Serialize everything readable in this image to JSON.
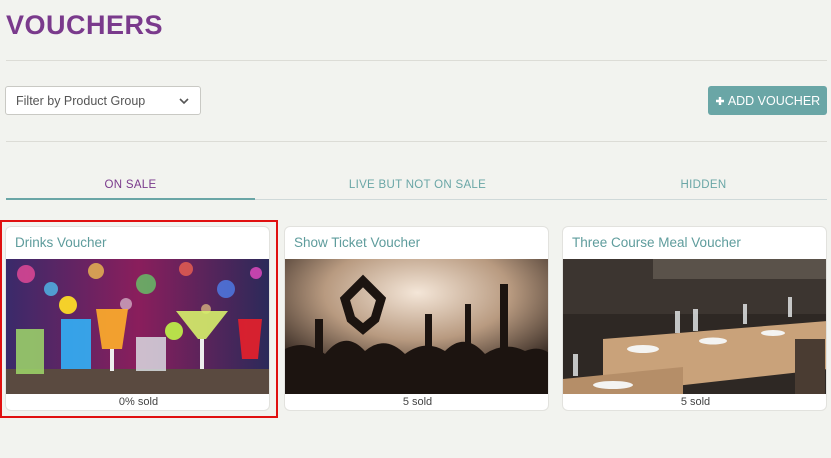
{
  "header": {
    "title": "VOUCHERS"
  },
  "filter": {
    "placeholder": "Filter by Product Group",
    "icon": "chevron-down-icon"
  },
  "actions": {
    "add_label": "ADD VOUCHER",
    "add_icon": "plus-icon"
  },
  "tabs": [
    {
      "label": "ON SALE",
      "active": true
    },
    {
      "label": "LIVE BUT NOT ON SALE",
      "active": false
    },
    {
      "label": "HIDDEN",
      "active": false
    }
  ],
  "vouchers": [
    {
      "name": "Drinks Voucher",
      "sold": "0% sold",
      "selected": true
    },
    {
      "name": "Show Ticket Voucher",
      "sold": "5 sold",
      "selected": false
    },
    {
      "name": "Three Course Meal Voucher",
      "sold": "5 sold",
      "selected": false
    }
  ],
  "colors": {
    "brand_purple": "#7a3a8c",
    "accent_teal": "#6aa6a6",
    "background": "#f2f3ef",
    "selection_red": "#e01010"
  }
}
